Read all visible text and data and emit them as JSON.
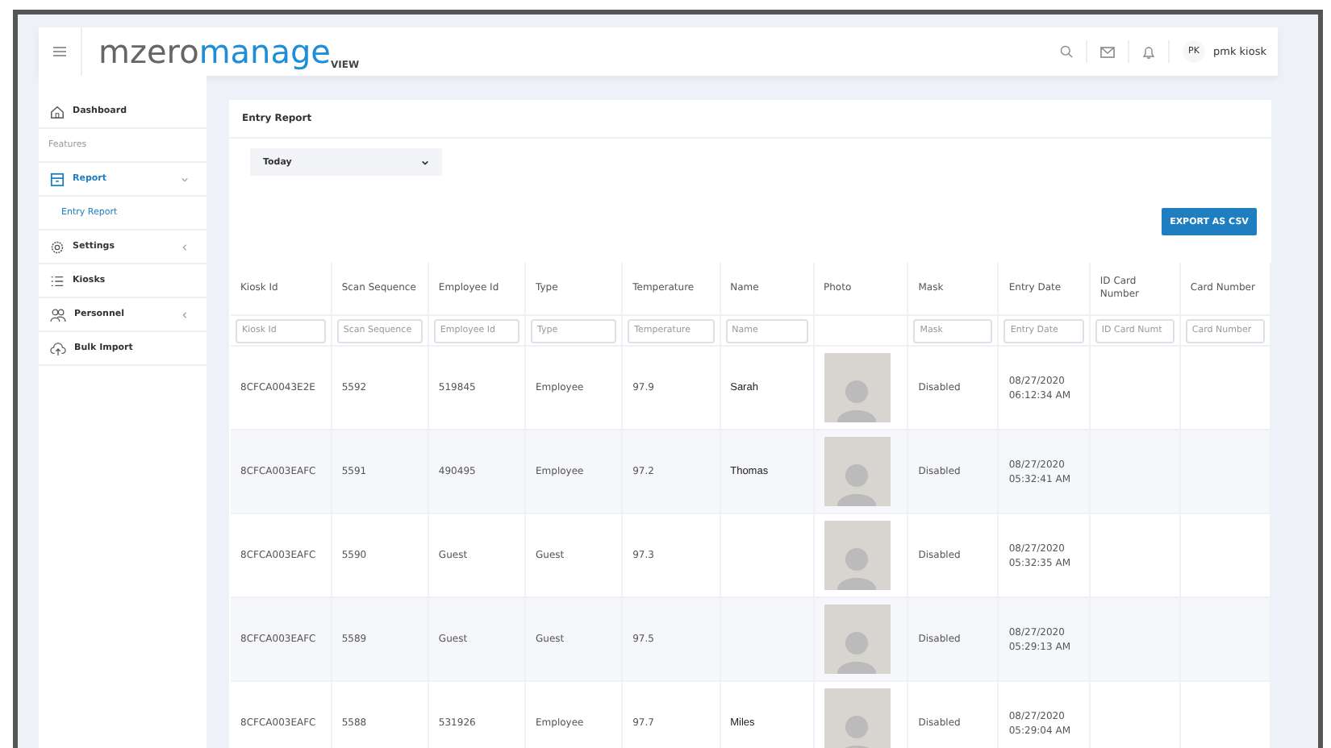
{
  "header": {
    "logo": {
      "part_1": "mzero",
      "part_2": "manage",
      "part_3": "VIEW"
    },
    "user": {
      "initials": "PK",
      "name": "pmk kiosk"
    }
  },
  "sidebar": {
    "items": [
      {
        "kind": "item",
        "label": "Dashboard",
        "selected": false
      },
      {
        "kind": "section",
        "label": "Features"
      },
      {
        "kind": "item",
        "label": "Report",
        "selected": true,
        "expanded": true,
        "children": [
          {
            "label": "Entry Report",
            "selected": true
          }
        ]
      },
      {
        "kind": "item",
        "label": "Settings",
        "selected": false,
        "expanded": false
      },
      {
        "kind": "item",
        "label": "Kiosks",
        "selected": false
      },
      {
        "kind": "item",
        "label": "Personnel",
        "selected": false,
        "expanded": false
      },
      {
        "kind": "item",
        "label": "Bulk Import",
        "selected": false
      }
    ]
  },
  "report": {
    "title": "Entry Report",
    "period": {
      "value": "Today"
    },
    "export_button": "EXPORT AS CSV",
    "table": {
      "columns": [
        {
          "label": "Kiosk Id",
          "filter_placeholder": "Kiosk Id"
        },
        {
          "label": "Scan Sequence",
          "filter_placeholder": "Scan Sequence"
        },
        {
          "label": "Employee Id",
          "filter_placeholder": "Employee Id"
        },
        {
          "label": "Type",
          "filter_placeholder": "Type"
        },
        {
          "label": "Temperature",
          "filter_placeholder": "Temperature"
        },
        {
          "label": "Name",
          "filter_placeholder": "Name"
        },
        {
          "label": "Photo"
        },
        {
          "label": "Mask",
          "filter_placeholder": "Mask"
        },
        {
          "label": "Entry Date",
          "filter_placeholder": "Entry Date"
        },
        {
          "label": "ID Card Number",
          "filter_placeholder": "ID Card Numt"
        },
        {
          "label": "Card Number",
          "filter_placeholder": "Card Number"
        }
      ],
      "rows": [
        {
          "kiosk_id": "8CFCA0043E2E",
          "scan_sequence": "5592",
          "employee_id": "519845",
          "type": "Employee",
          "temperature": "97.9",
          "name": "Sarah",
          "mask": "Disabled",
          "entry_date": "08/27/2020",
          "entry_time": "06:12:34 AM"
        },
        {
          "kiosk_id": "8CFCA003EAFC",
          "scan_sequence": "5591",
          "employee_id": "490495",
          "type": "Employee",
          "temperature": "97.2",
          "name": "Thomas",
          "mask": "Disabled",
          "entry_date": "08/27/2020",
          "entry_time": "05:32:41 AM"
        },
        {
          "kiosk_id": "8CFCA003EAFC",
          "scan_sequence": "5590",
          "employee_id": "Guest",
          "type": "Guest",
          "temperature": "97.3",
          "mask": "Disabled",
          "entry_date": "08/27/2020",
          "entry_time": "05:32:35 AM"
        },
        {
          "kiosk_id": "8CFCA003EAFC",
          "scan_sequence": "5589",
          "employee_id": "Guest",
          "type": "Guest",
          "temperature": "97.5",
          "mask": "Disabled",
          "entry_date": "08/27/2020",
          "entry_time": "05:29:13 AM"
        },
        {
          "kiosk_id": "8CFCA003EAFC",
          "scan_sequence": "5588",
          "employee_id": "531926",
          "type": "Employee",
          "temperature": "97.7",
          "name": "Miles",
          "mask": "Disabled",
          "entry_date": "08/27/2020",
          "entry_time": "05:29:04 AM"
        }
      ]
    }
  }
}
